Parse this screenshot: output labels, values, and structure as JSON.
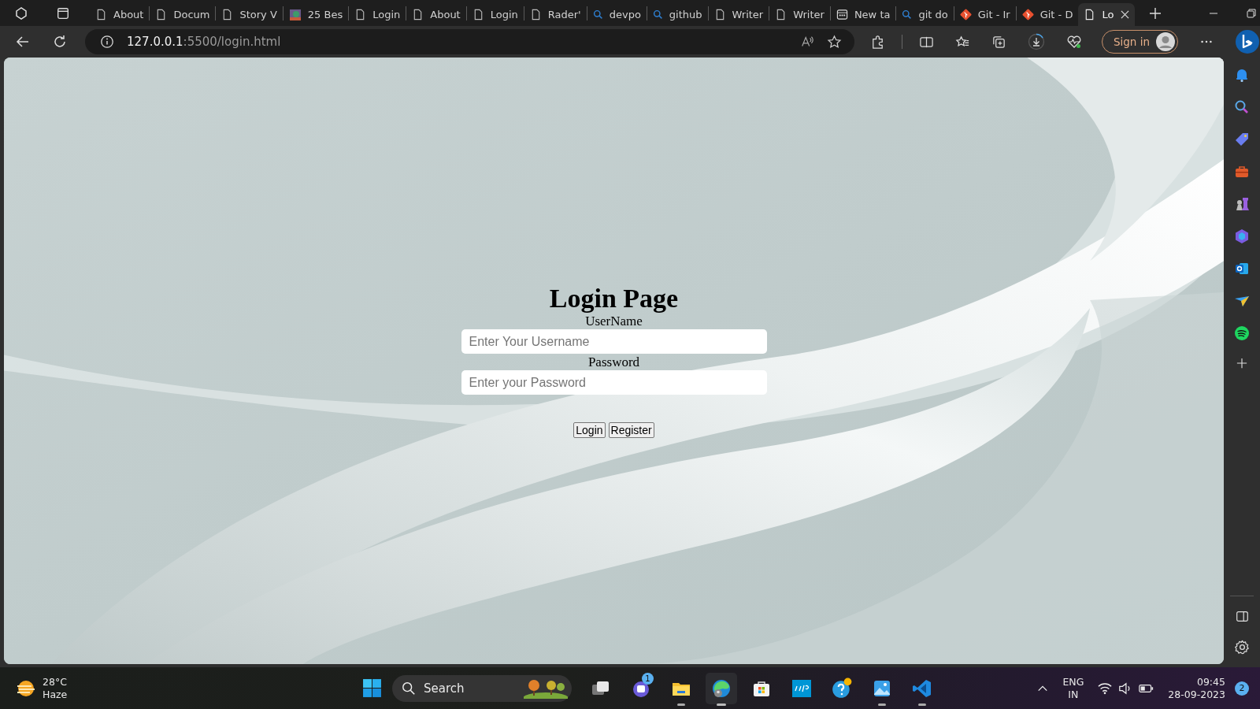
{
  "browser": {
    "tabs": [
      {
        "label": "About",
        "kind": "page",
        "selected": false
      },
      {
        "label": "Docum",
        "kind": "page",
        "selected": false
      },
      {
        "label": "Story V",
        "kind": "page",
        "selected": false
      },
      {
        "label": "25 Bes",
        "selected": false
      },
      {
        "label": "Login",
        "kind": "page",
        "selected": false
      },
      {
        "label": "About",
        "kind": "page",
        "selected": false
      },
      {
        "label": "Login",
        "kind": "page",
        "selected": false
      },
      {
        "label": "Rader'",
        "kind": "page",
        "selected": false
      },
      {
        "label": "devpo",
        "kind": "search",
        "selected": false
      },
      {
        "label": "github",
        "kind": "search",
        "selected": false
      },
      {
        "label": "Writer",
        "kind": "page",
        "selected": false
      },
      {
        "label": "Writer",
        "kind": "page",
        "selected": false
      },
      {
        "label": "New ta",
        "kind": "newtab",
        "selected": false
      },
      {
        "label": "git do",
        "kind": "search",
        "selected": false
      },
      {
        "label": "Git - Ir",
        "kind": "git",
        "selected": false
      },
      {
        "label": "Git - D",
        "kind": "git",
        "selected": false
      },
      {
        "label": "Lo",
        "kind": "page",
        "selected": true
      }
    ],
    "address": {
      "host": "127.0.0.1",
      "path": ":5500/login.html"
    },
    "sign_in": "Sign in",
    "sidebar": [
      {
        "kind": "bell"
      },
      {
        "kind": "search"
      },
      {
        "kind": "tag"
      },
      {
        "kind": "toolbox"
      },
      {
        "kind": "games"
      },
      {
        "kind": "office"
      },
      {
        "kind": "outlook"
      },
      {
        "kind": "send"
      },
      {
        "kind": "spotify"
      },
      {
        "kind": "add"
      }
    ]
  },
  "page": {
    "heading": "Login Page",
    "fields": [
      {
        "label": "UserName",
        "placeholder": "Enter Your Username"
      },
      {
        "label": "Password",
        "placeholder": "Enter your Password"
      }
    ],
    "buttons": [
      "Login",
      "Register"
    ]
  },
  "taskbar": {
    "weather": {
      "temperature": "28°C",
      "condition": "Haze"
    },
    "search": {
      "placeholder": "Search"
    },
    "apps": [
      {
        "kind": "taskview",
        "running": false,
        "selected": false
      },
      {
        "kind": "teams",
        "running": false,
        "selected": false,
        "badge": "1"
      },
      {
        "kind": "files",
        "running": true,
        "selected": false
      },
      {
        "kind": "edge",
        "running": true,
        "selected": true
      },
      {
        "kind": "store",
        "running": false,
        "selected": false
      },
      {
        "kind": "myhp",
        "running": false,
        "selected": false
      },
      {
        "kind": "help",
        "running": false,
        "selected": false
      },
      {
        "kind": "photos",
        "running": true,
        "selected": false
      },
      {
        "kind": "vscode",
        "running": true,
        "selected": false
      }
    ],
    "tray": {
      "language": "ENG",
      "region": "IN",
      "time": "09:45",
      "date": "28-09-2023",
      "notifications": "2"
    }
  }
}
